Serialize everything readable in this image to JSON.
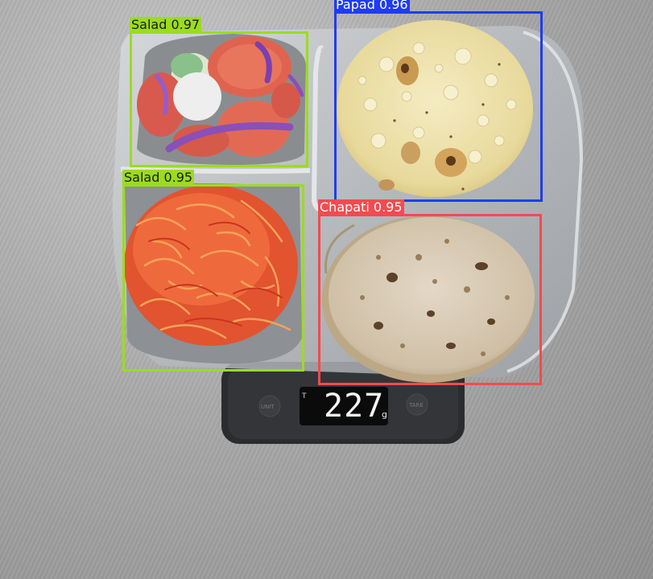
{
  "scene": {
    "description": "Divided steel thali on a digital kitchen scale with object-detection boxes",
    "colors": {
      "salad_box": "#9bdc1e",
      "papad_box": "#1f3cf0",
      "chapati_box": "#f24b50"
    }
  },
  "detections": [
    {
      "class": "Salad",
      "score": "0.97",
      "label": "Salad 0.97"
    },
    {
      "class": "Papad",
      "score": "0.96",
      "label": "Papad 0.96"
    },
    {
      "class": "Salad",
      "score": "0.95",
      "label": "Salad 0.95"
    },
    {
      "class": "Chapati",
      "score": "0.95",
      "label": "Chapati 0.95"
    }
  ],
  "scale": {
    "reading": "227",
    "unit": "g",
    "indicator": "T",
    "left_button": "UNIT",
    "right_button": "TARE"
  }
}
